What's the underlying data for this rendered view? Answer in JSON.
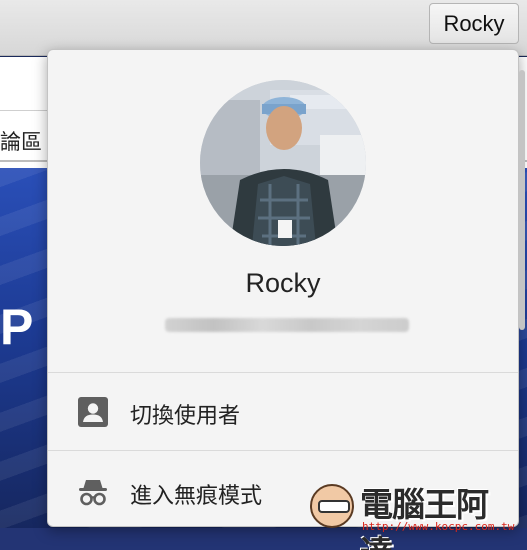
{
  "toolbar": {
    "profile_chip_label": "Rocky"
  },
  "page": {
    "fragment_text": "論區",
    "hero_letter": "P"
  },
  "profile_menu": {
    "user_name": "Rocky",
    "email_obscured": true,
    "items": [
      {
        "label": "切換使用者",
        "icon": "account-box-icon"
      },
      {
        "label": "進入無痕模式",
        "icon": "incognito-icon"
      }
    ]
  },
  "watermark": {
    "title": "電腦王阿達",
    "url": "http://www.kocpc.com.tw"
  },
  "colors": {
    "popup_background": "#f4f4f4",
    "icon_color": "#5f5f5f",
    "page_hero_blue": "#1d3b94"
  }
}
